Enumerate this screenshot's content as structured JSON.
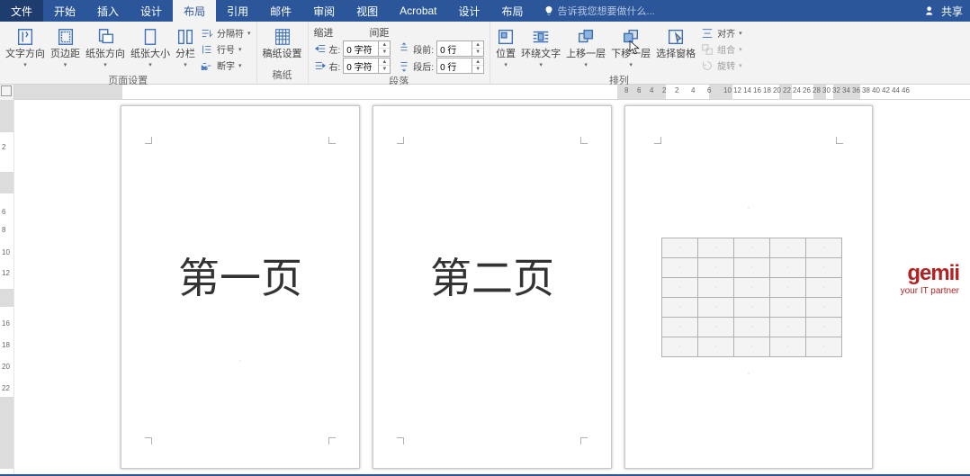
{
  "tabs": {
    "file": "文件",
    "home": "开始",
    "insert": "插入",
    "design": "设计",
    "layout": "布局",
    "references": "引用",
    "mail": "邮件",
    "review": "审阅",
    "view": "视图",
    "acrobat": "Acrobat",
    "design2": "设计",
    "layout2": "布局"
  },
  "tellme": "告诉我您想要做什么...",
  "share": "共享",
  "groups": {
    "page_setup": "页面设置",
    "draft": "稿纸",
    "paragraph": "段落",
    "arrange": "排列"
  },
  "page_setup_btns": {
    "text_dir": "文字方向",
    "margins": "页边距",
    "orientation": "纸张方向",
    "size": "纸张大小",
    "columns": "分栏"
  },
  "page_setup_small": {
    "breaks": "分隔符",
    "line_no": "行号",
    "hyphen": "断字"
  },
  "draft_btn": "稿纸设置",
  "para": {
    "indent_h": "缩进",
    "spacing_h": "间距",
    "left_l": "左:",
    "right_l": "右:",
    "before_l": "段前:",
    "after_l": "段后:",
    "left_v": "0 字符",
    "right_v": "0 字符",
    "before_v": "0 行",
    "after_v": "0 行"
  },
  "arrange_btns": {
    "position": "位置",
    "wrap": "环绕文字",
    "forward": "上移一层",
    "backward": "下移一层",
    "select": "选择窗格",
    "align": "对齐",
    "group": "组合",
    "rotate": "旋转"
  },
  "ruler_numbers": [
    "8",
    "6",
    "4",
    "2",
    "2",
    "4",
    "6",
    "10",
    "12",
    "14",
    "16",
    "18",
    "20",
    "22",
    "24",
    "26",
    "28",
    "30",
    "32",
    "34",
    "36",
    "38",
    "40",
    "42",
    "44",
    "46"
  ],
  "pages": {
    "p1": "第一页",
    "p2": "第二页"
  },
  "logo": {
    "brand": "gemii",
    "tag": "your IT partner"
  }
}
